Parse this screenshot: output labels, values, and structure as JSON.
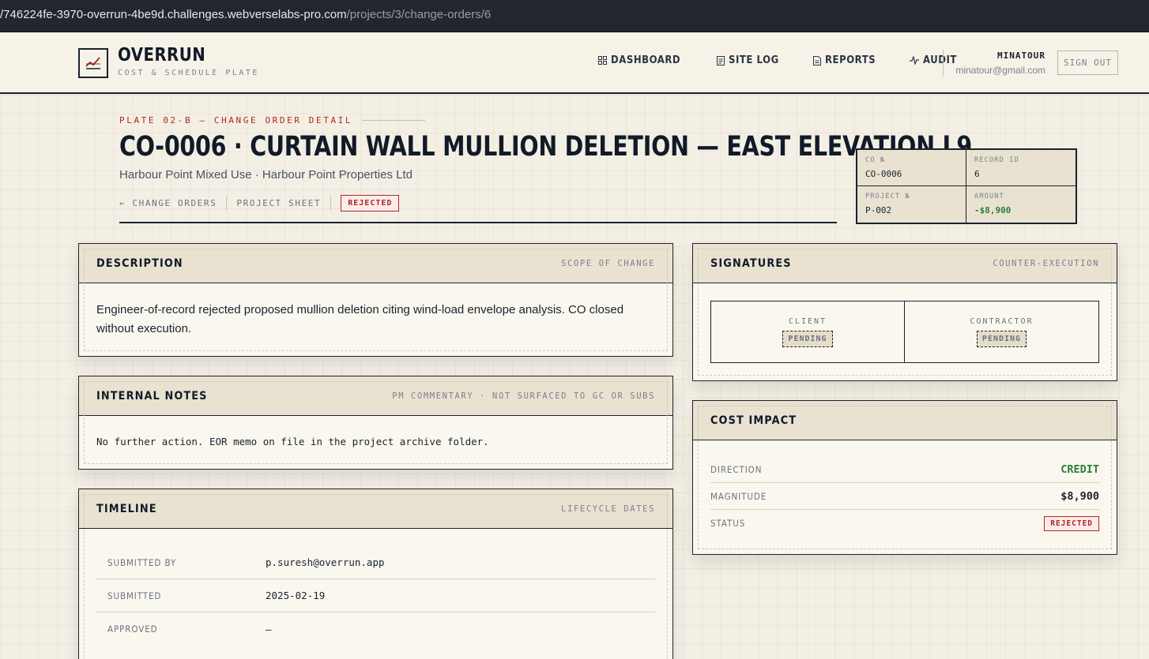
{
  "browser": {
    "url_host": "/746224fe-3970-overrun-4be9d.challenges.webverselabs-pro.com",
    "url_path": "/projects/3/change-orders/6"
  },
  "header": {
    "brand": "OVERRUN",
    "tagline": "COST & SCHEDULE PLATE",
    "nav": [
      {
        "label": "DASHBOARD",
        "icon": "grid-icon"
      },
      {
        "label": "SITE LOG",
        "icon": "log-icon"
      },
      {
        "label": "REPORTS",
        "icon": "document-icon"
      },
      {
        "label": "AUDIT",
        "icon": "pulse-icon"
      }
    ],
    "user_name": "MINATOUR",
    "user_email": "minatour@gmail.com",
    "signout_label": "SIGN OUT"
  },
  "page": {
    "kicker": "PLATE 02-B — CHANGE ORDER DETAIL",
    "title": "CO-0006 · CURTAIN WALL MULLION DELETION — EAST ELEVATION L9",
    "subtitle": "Harbour Point Mixed Use · Harbour Point Properties Ltd",
    "crumbs": {
      "back": "← CHANGE ORDERS",
      "sheet": "PROJECT SHEET",
      "status": "REJECTED"
    }
  },
  "meta": {
    "co_label": "CO №",
    "co_value": "CO-0006",
    "record_label": "RECORD ID",
    "record_value": "6",
    "project_label": "PROJECT №",
    "project_value": "P-002",
    "amount_label": "AMOUNT",
    "amount_value": "-$8,900",
    "amount_color": "#2e7d3c"
  },
  "description": {
    "title": "DESCRIPTION",
    "tag": "SCOPE OF CHANGE",
    "text": "Engineer-of-record rejected proposed mullion deletion citing wind-load envelope analysis. CO closed without execution."
  },
  "notes": {
    "title": "INTERNAL NOTES",
    "tag": "PM COMMENTARY · NOT SURFACED TO GC OR SUBS",
    "text": "No further action. EOR memo on file in the project archive folder."
  },
  "timeline": {
    "title": "TIMELINE",
    "tag": "LIFECYCLE DATES",
    "rows": [
      {
        "label": "SUBMITTED BY",
        "value": "p.suresh@overrun.app"
      },
      {
        "label": "SUBMITTED",
        "value": "2025-02-19"
      },
      {
        "label": "APPROVED",
        "value": "—"
      }
    ]
  },
  "signatures": {
    "title": "SIGNATURES",
    "tag": "COUNTER-EXECUTION",
    "client_label": "CLIENT",
    "client_status": "PENDING",
    "contractor_label": "CONTRACTOR",
    "contractor_status": "PENDING"
  },
  "cost_impact": {
    "title": "COST IMPACT",
    "direction_label": "DIRECTION",
    "direction_value": "CREDIT",
    "magnitude_label": "MAGNITUDE",
    "magnitude_value": "$8,900",
    "status_label": "STATUS",
    "status_value": "REJECTED"
  },
  "colors": {
    "accent_red": "#b3261e",
    "credit_green": "#2e7d3c",
    "ink": "#1a2230",
    "paper": "#f3efe4"
  }
}
